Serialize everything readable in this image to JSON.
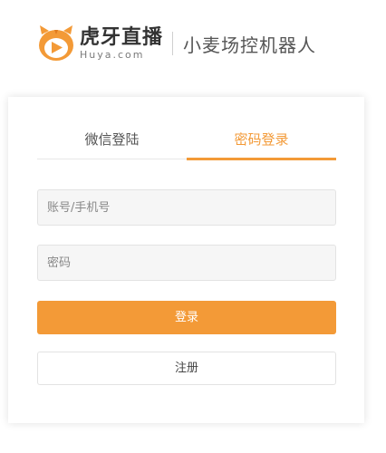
{
  "header": {
    "brand_name": "虎牙直播",
    "brand_domain": "Huya.com",
    "app_title": "小麦场控机器人",
    "logo_icon": "huya-tiger-logo-icon",
    "brand_color": "#f39a37"
  },
  "login": {
    "tabs": [
      {
        "label": "微信登陆",
        "active": false
      },
      {
        "label": "密码登录",
        "active": true
      }
    ],
    "account_placeholder": "账号/手机号",
    "password_placeholder": "密码",
    "login_button": "登录",
    "register_button": "注册"
  }
}
